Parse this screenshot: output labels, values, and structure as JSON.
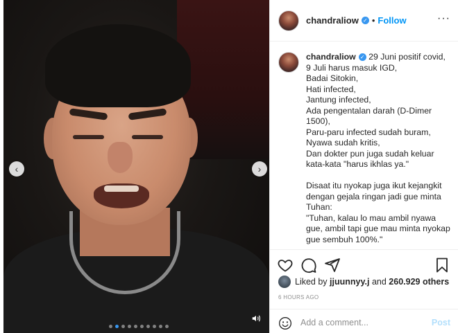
{
  "post": {
    "username": "chandraliow",
    "follow_label": "Follow",
    "separator": "•",
    "more_label": "···",
    "nav_prev": "‹",
    "nav_next": "›",
    "carousel_count": 10,
    "carousel_active": 1
  },
  "caption": {
    "first_line_rest": "29 Juni positif covid,",
    "lines": [
      "9 Juli harus masuk IGD,",
      "Badai Sitokin,",
      "Hati infected,",
      "Jantung infected,",
      "Ada pengentalan darah (D-Dimer",
      "1500),",
      "Paru-paru infected sudah buram,",
      "Nyawa sudah kritis,",
      "Dan dokter pun juga sudah keluar",
      "kata-kata \"harus ikhlas ya.\"",
      "",
      "Disaat itu nyokap juga ikut kejangkit",
      "dengan gejala ringan jadi gue minta",
      "Tuhan:",
      "\"Tuhan, kalau lo mau ambil nyawa",
      "gue, ambil tapi gue mau minta nyokap",
      "gue sembuh 100%.\""
    ]
  },
  "likes": {
    "prefix": "Liked by",
    "user": "jjuunnyy.j",
    "and": "and",
    "count": "260.929 others"
  },
  "timestamp": "6 HOURS AGO",
  "comment": {
    "placeholder": "Add a comment...",
    "post_label": "Post"
  },
  "icons": {
    "like": "heart-icon",
    "comment": "comment-icon",
    "share": "share-icon",
    "save": "bookmark-icon",
    "emoji": "emoji-icon",
    "sound": "speaker-icon",
    "verified": "verified-badge-icon"
  },
  "colors": {
    "accent": "#0095f6",
    "verified": "#3897f0",
    "muted": "#8e8e8e",
    "post_disabled": "#b2dffc"
  }
}
